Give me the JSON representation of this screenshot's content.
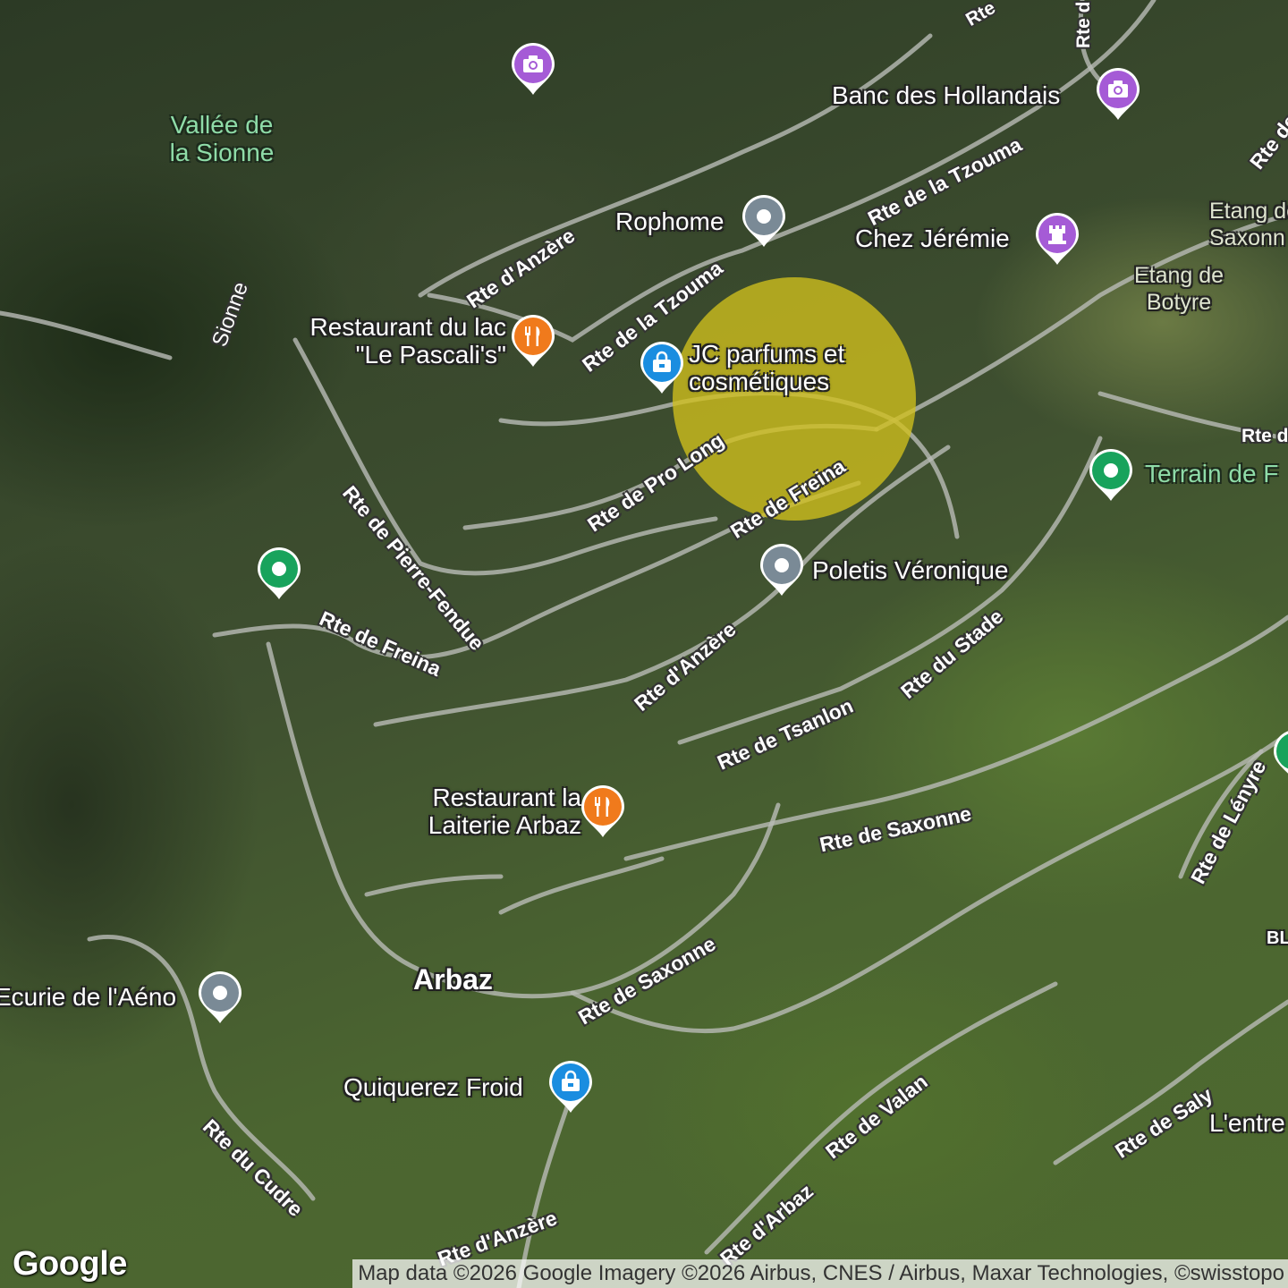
{
  "map": {
    "places": [
      {
        "id": "vallee",
        "label": "Vallée de la Sionne"
      },
      {
        "id": "banc",
        "label": "Banc des Hollandais"
      },
      {
        "id": "rophome",
        "label": "Rophome"
      },
      {
        "id": "chez",
        "label": "Chez Jérémie"
      },
      {
        "id": "etang-saxon",
        "label": "Etang de Saxonn"
      },
      {
        "id": "etang-botyre",
        "label": "Etang de Botyre"
      },
      {
        "id": "pascalis",
        "label": "Restaurant du lac \"Le Pascali's\""
      },
      {
        "id": "jc",
        "label": "JC parfums et cosmétiques"
      },
      {
        "id": "terrain",
        "label": "Terrain de F"
      },
      {
        "id": "poletis",
        "label": "Poletis Véronique"
      },
      {
        "id": "laiterie",
        "label": "Restaurant la Laiterie Arbaz"
      },
      {
        "id": "arbaz",
        "label": "Arbaz"
      },
      {
        "id": "ecurie",
        "label": "Ecurie de l'Aéno"
      },
      {
        "id": "quiquerez",
        "label": "Quiquerez Froid"
      },
      {
        "id": "lentre",
        "label": "L'entre"
      },
      {
        "id": "bl",
        "label": "BL"
      }
    ],
    "roads": [
      {
        "id": "r1",
        "label": "Rte d'Anzère"
      },
      {
        "id": "r2",
        "label": "Rte de la Tzouma"
      },
      {
        "id": "r3",
        "label": "Rte de la Tzouma"
      },
      {
        "id": "r4",
        "label": "Sionne"
      },
      {
        "id": "r5",
        "label": "Rte de Pierre-Fendue"
      },
      {
        "id": "r6",
        "label": "Rte de Pro Long"
      },
      {
        "id": "r7",
        "label": "Rte de Freina"
      },
      {
        "id": "r8",
        "label": "Rte de Freina"
      },
      {
        "id": "r9",
        "label": "Rte d'Anzère"
      },
      {
        "id": "r10",
        "label": "Rte du Stade"
      },
      {
        "id": "r11",
        "label": "Rte de Tsanlon"
      },
      {
        "id": "r12",
        "label": "Rte de Saxonne"
      },
      {
        "id": "r13",
        "label": "Rte de Saxonne"
      },
      {
        "id": "r14",
        "label": "Rte de Lényre"
      },
      {
        "id": "r15",
        "label": "Rte du Cudre"
      },
      {
        "id": "r16",
        "label": "Rte de Valan"
      },
      {
        "id": "r17",
        "label": "Rte de Saly"
      },
      {
        "id": "r18",
        "label": "Rte d'Arbaz"
      },
      {
        "id": "r19",
        "label": "Rte d'Anzère"
      },
      {
        "id": "r20",
        "label": "Rte des"
      },
      {
        "id": "r21",
        "label": "Rte d"
      },
      {
        "id": "r22",
        "label": "Rte d"
      },
      {
        "id": "r23",
        "label": "Rte"
      }
    ],
    "colors": {
      "photo": "#a55bd6",
      "shopping": "#1a8de0",
      "restaurant": "#f07a1c",
      "generic": "#7a8a96",
      "park": "#18a35c",
      "highlight": "#d1c01c"
    },
    "pin_icons": {
      "photo": "camera-icon",
      "shopping": "shopping-bag-icon",
      "restaurant": "fork-knife-icon",
      "generic": "dot-icon",
      "park": "dot-icon",
      "castle": "castle-icon"
    }
  },
  "brand": {
    "logo": "Google"
  },
  "attribution": "Map data ©2026 Google Imagery ©2026 Airbus, CNES / Airbus, Maxar Technologies, ©swisstopo"
}
